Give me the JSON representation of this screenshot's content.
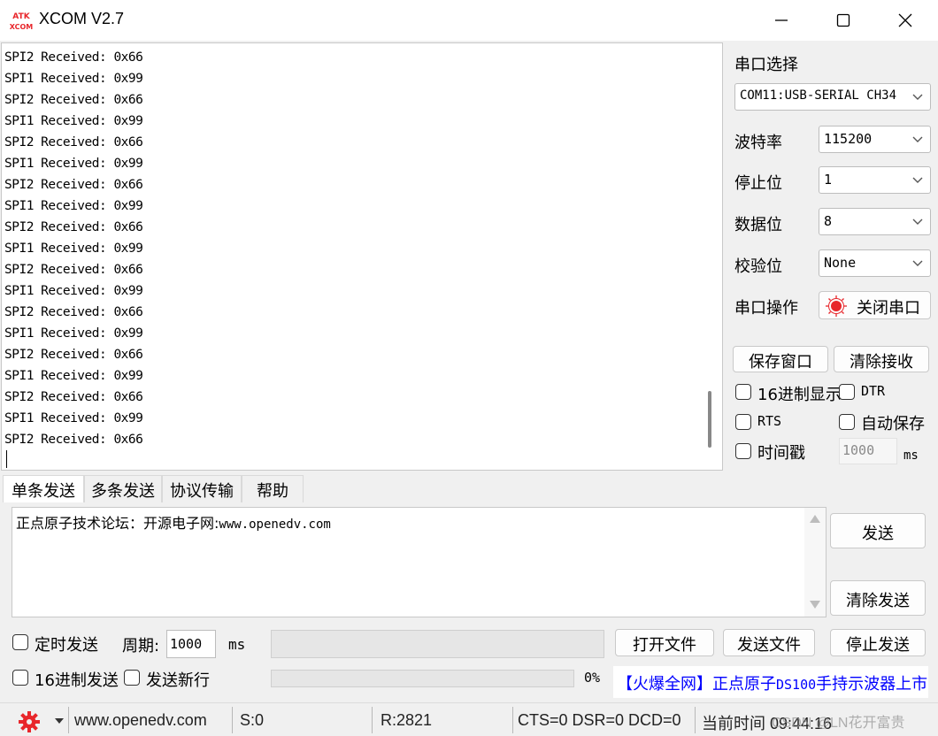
{
  "window": {
    "title": "XCOM V2.7",
    "logo_text_top": "ATK",
    "logo_text_bottom": "XCOM",
    "accent": "#e8262b"
  },
  "receive": {
    "lines": [
      "SPI2 Received: 0x66",
      "SPI1 Received: 0x99",
      "SPI2 Received: 0x66",
      "SPI1 Received: 0x99",
      "SPI2 Received: 0x66",
      "SPI1 Received: 0x99",
      "SPI2 Received: 0x66",
      "SPI1 Received: 0x99",
      "SPI2 Received: 0x66",
      "SPI1 Received: 0x99",
      "SPI2 Received: 0x66",
      "SPI1 Received: 0x99",
      "SPI2 Received: 0x66",
      "SPI1 Received: 0x99",
      "SPI2 Received: 0x66",
      "SPI1 Received: 0x99",
      "SPI2 Received: 0x66",
      "SPI1 Received: 0x99",
      "SPI2 Received: 0x66"
    ]
  },
  "settings": {
    "port_label": "串口选择",
    "port_value": "COM11:USB-SERIAL CH34",
    "baud_label": "波特率",
    "baud_value": "115200",
    "stop_label": "停止位",
    "stop_value": "1",
    "data_label": "数据位",
    "data_value": "8",
    "parity_label": "校验位",
    "parity_value": "None",
    "op_label": "串口操作",
    "close_port": "关闭串口",
    "save_window": "保存窗口",
    "clear_receive": "清除接收",
    "hex_display": "16进制显示",
    "dtr": "DTR",
    "rts": "RTS",
    "auto_save": "自动保存",
    "timestamp": "时间戳",
    "timestamp_value": "1000",
    "ms": "ms"
  },
  "tabs": [
    "单条发送",
    "多条发送",
    "协议传输",
    "帮助"
  ],
  "send": {
    "text_prefix": "正点原子技术论坛：开源电子网:",
    "text_url": "www.openedv.com",
    "send_button": "发送",
    "clear_send": "清除发送",
    "timed_send": "定时发送",
    "period_label": "周期:",
    "period_value": "1000",
    "ms": "ms",
    "open_file": "打开文件",
    "send_file": "发送文件",
    "stop_send": "停止发送",
    "hex_send": "16进制发送",
    "send_newline": "发送新行",
    "progress_text": "0%",
    "progress_value": 0
  },
  "ad": {
    "text_a": "【火爆全网】正点原子",
    "text_mono": "DS100",
    "text_b": "手持示波器上市"
  },
  "status": {
    "url": "www.openedv.com",
    "sent": "S:0",
    "received": "R:2821",
    "lines": "CTS=0 DSR=0 DCD=0",
    "time": "当前时间 09:44:16",
    "watermark": "CSDN @LN花开富贵"
  }
}
